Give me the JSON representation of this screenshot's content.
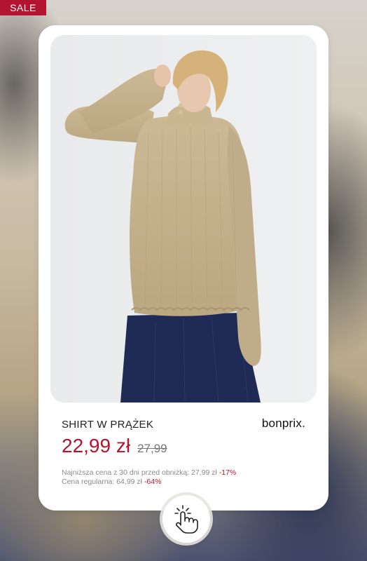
{
  "badge": {
    "label": "SALE"
  },
  "product": {
    "name": "SHIRT W PRĄŻEK",
    "brand": "bonprix.",
    "price_current": "22,99 zł",
    "price_old": "27,99",
    "lowest_price_text": "Najniższa cena z 30 dni przed obniżką: 27,99 zł",
    "lowest_price_discount": "-17%",
    "regular_price_text": "Cena regularna: 64,99 zł",
    "regular_price_discount": "-64%"
  },
  "icons": {
    "tap": "hand-tap-icon",
    "photo": "product-photo"
  },
  "colors": {
    "accent": "#b3142f",
    "card": "#ffffff",
    "sweater": "#c4b28f",
    "trousers": "#1f2b55"
  }
}
